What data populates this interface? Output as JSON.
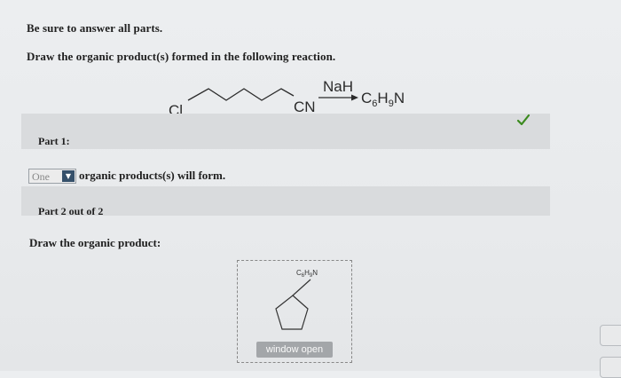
{
  "instructions": {
    "line1": "Be sure to answer all parts.",
    "line2": "Draw the organic product(s) formed in the following reaction."
  },
  "reaction": {
    "cl": "Cl",
    "cn": "CN",
    "reagent": "NaH",
    "product": {
      "c": "C",
      "c_sub": "6",
      "h": "H",
      "h_sub": "9",
      "n": "N"
    }
  },
  "part1": {
    "label": "Part 1:",
    "select_value": "One",
    "select_suffix": "organic products(s) will form.",
    "status_color": "#3b8a1e"
  },
  "part2": {
    "label": "Part 2 out of 2",
    "prompt": "Draw the organic product:",
    "canvas_label": {
      "c": "C",
      "c_sub": "6",
      "h": "H",
      "h_sub": "9",
      "n": "N"
    },
    "window_button": "window open"
  },
  "icons": {
    "status": "checkmark-icon",
    "dropdown": "caret-down-icon"
  }
}
